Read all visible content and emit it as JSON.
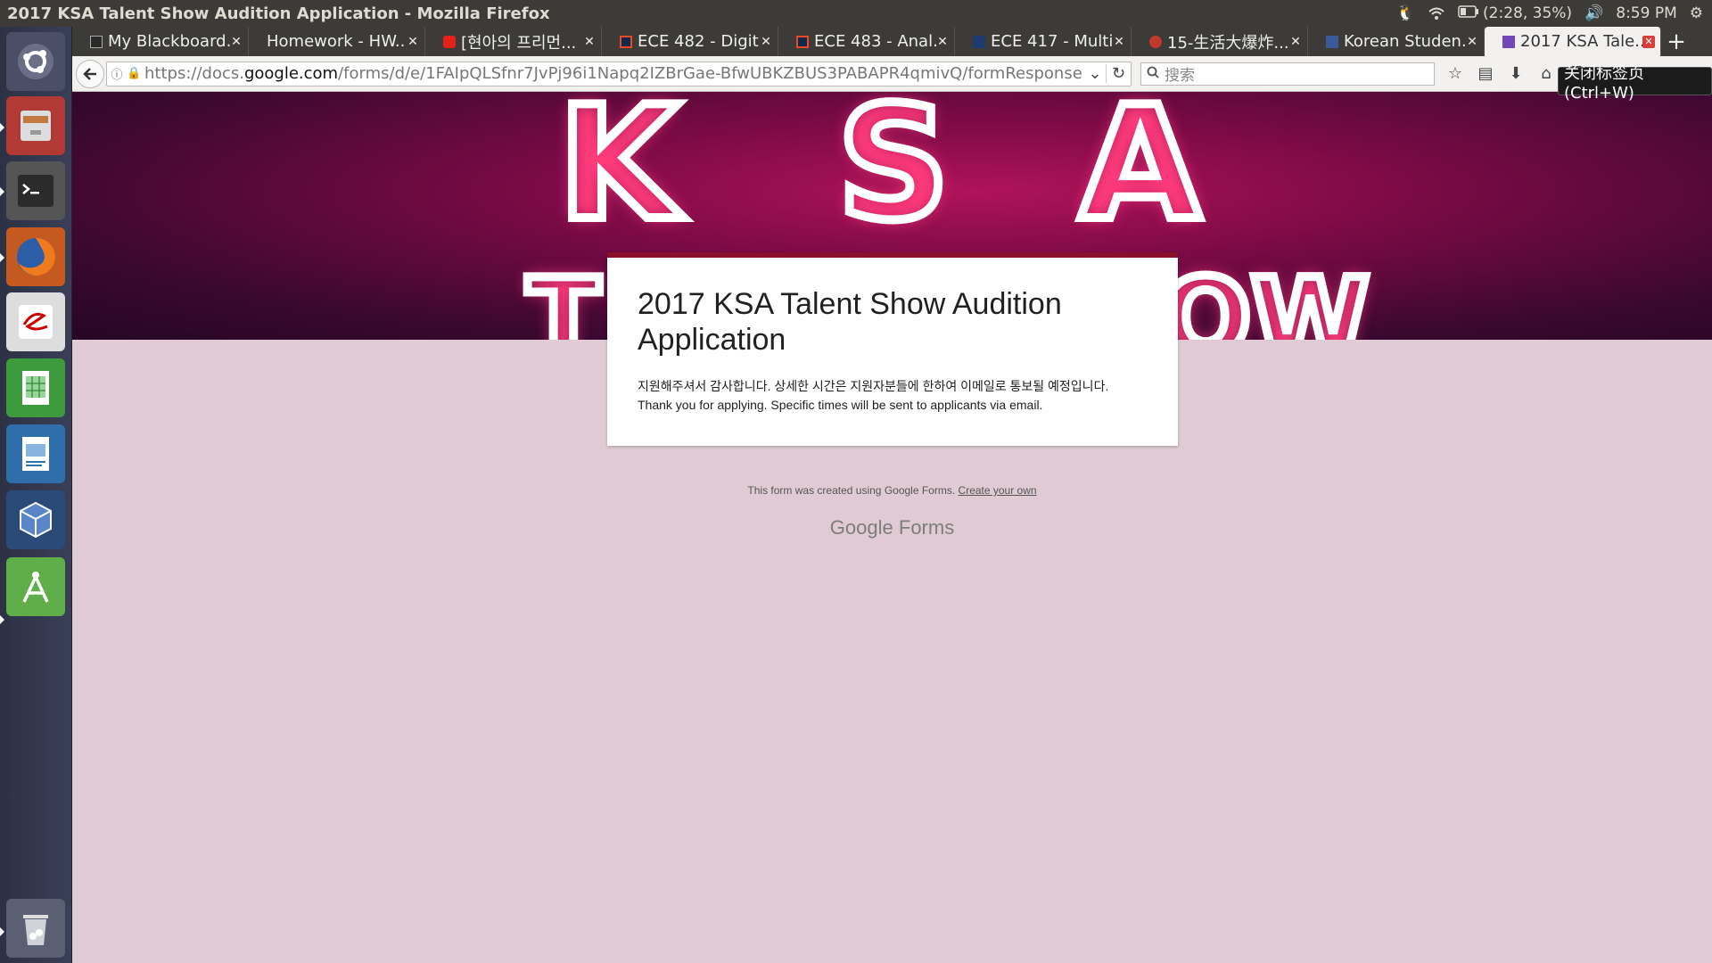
{
  "window": {
    "title": "2017 KSA Talent Show Audition Application - Mozilla Firefox"
  },
  "indicators": {
    "battery": "(2:28, 35%)",
    "time": "8:59 PM"
  },
  "tabs": [
    {
      "label": "My Blackboard...",
      "icon": "blackboard-icon"
    },
    {
      "label": "Homework - HW...",
      "icon": "none"
    },
    {
      "label": "[현아의 프리먼...",
      "icon": "youtube-icon"
    },
    {
      "label": "ECE 482 - Digit...",
      "icon": "illinois-icon"
    },
    {
      "label": "ECE 483 - Anal...",
      "icon": "illinois-icon"
    },
    {
      "label": "ECE 417 - Multi...",
      "icon": "ece-icon"
    },
    {
      "label": "15-生活大爆炸...",
      "icon": "video-icon"
    },
    {
      "label": "Korean Studen...",
      "icon": "facebook-icon"
    },
    {
      "label": "2017 KSA Tale...",
      "icon": "google-forms-icon",
      "active": true
    }
  ],
  "navbar": {
    "url_prefix": "https://docs.",
    "url_domain": "google.com",
    "url_rest": "/forms/d/e/1FAIpQLSfnr7JvPj96i1Napq2IZBrGae-BfwUBKZBUS3PABAPR4qmivQ/formResponse",
    "search_placeholder": "搜索"
  },
  "tooltip": "关闭标签页 (Ctrl+W)",
  "banner": {
    "letters": [
      "K",
      "S",
      "A"
    ],
    "lower_left": "T",
    "lower_right": "OW"
  },
  "form": {
    "title": "2017 KSA Talent Show Audition Application",
    "desc_ko": "지원해주셔서 감사합니다. 상세한 시간은 지원자분들에 한하여 이메일로 통보될 예정입니다.",
    "desc_en": "Thank you for applying. Specific times will be sent to applicants via email."
  },
  "footer": {
    "note": "This form was created using Google Forms.",
    "link": "Create your own",
    "logo_google": "Google",
    "logo_forms": "Forms"
  },
  "colors": {
    "accent": "#8a0f2b",
    "page_bg": "#e0cbd4"
  }
}
